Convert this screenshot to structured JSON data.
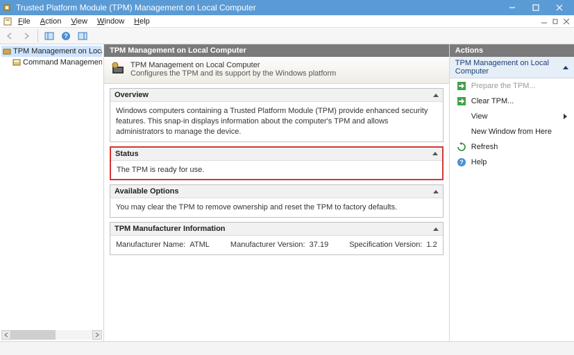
{
  "window": {
    "title": "Trusted Platform Module (TPM) Management on Local Computer"
  },
  "menu": {
    "file": "File",
    "action": "Action",
    "view": "View",
    "window": "Window",
    "help": "Help"
  },
  "tree": {
    "root": "TPM Management on Local Compu",
    "child": "Command Management"
  },
  "content": {
    "header": "TPM Management on Local Computer",
    "desc1": "TPM Management on Local Computer",
    "desc2": "Configures the TPM and its support by the Windows platform",
    "overview": {
      "title": "Overview",
      "body": "Windows computers containing a Trusted Platform Module (TPM) provide enhanced security features. This snap-in displays information about the computer's TPM and allows administrators to manage the device."
    },
    "status": {
      "title": "Status",
      "body": "The TPM is ready for use."
    },
    "options": {
      "title": "Available Options",
      "body": "You may clear the TPM to remove ownership and reset the TPM to factory defaults."
    },
    "mfg": {
      "title": "TPM Manufacturer Information",
      "name_label": "Manufacturer Name:",
      "name_value": "ATML",
      "ver_label": "Manufacturer Version:",
      "ver_value": "37.19",
      "spec_label": "Specification Version:",
      "spec_value": "1.2"
    }
  },
  "actions": {
    "title": "Actions",
    "subtitle": "TPM Management on Local Computer",
    "prepare": "Prepare the TPM...",
    "clear": "Clear TPM...",
    "view": "View",
    "newwin": "New Window from Here",
    "refresh": "Refresh",
    "help": "Help"
  }
}
